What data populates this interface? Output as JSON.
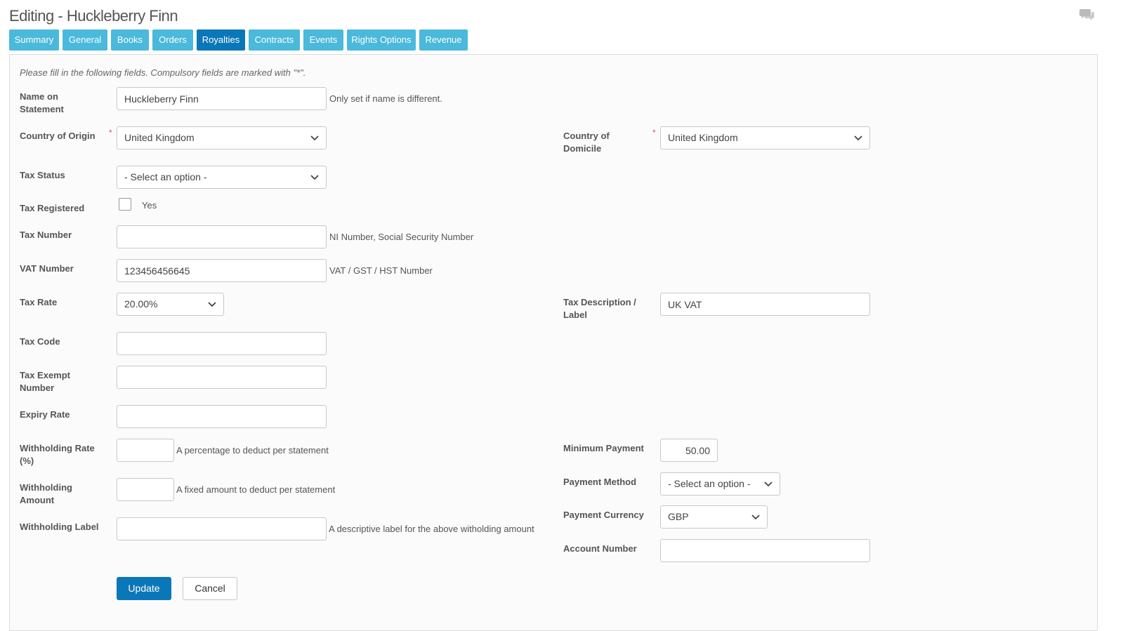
{
  "title": "Editing - Huckleberry Finn",
  "icons": {
    "chat": "chat-bubbles-icon",
    "chevron": "chevron-down-icon"
  },
  "colors": {
    "tab": "#4ab9db",
    "tab_active": "#0a77b8",
    "required": "#d9534f",
    "primary": "#0a77b8"
  },
  "tabs": [
    "Summary",
    "General",
    "Books",
    "Orders",
    "Royalties",
    "Contracts",
    "Events",
    "Rights Options",
    "Revenue"
  ],
  "active_tab": "Royalties",
  "intro": "Please fill in the following fields. Compulsory fields are marked with \"*\".",
  "required_mark": "*",
  "fields": {
    "name_on_statement": {
      "label": "Name on Statement",
      "value": "Huckleberry Finn",
      "help": "Only set if name is different."
    },
    "country_of_origin": {
      "label": "Country of Origin",
      "value": "United Kingdom"
    },
    "country_of_domicile": {
      "label": "Country of Domicile",
      "value": "United Kingdom"
    },
    "tax_status": {
      "label": "Tax Status",
      "value": "- Select an option -"
    },
    "tax_registered": {
      "label": "Tax Registered",
      "option": "Yes",
      "checked": false
    },
    "tax_number": {
      "label": "Tax Number",
      "value": "",
      "help": "NI Number, Social Security Number"
    },
    "vat_number": {
      "label": "VAT Number",
      "value": "123456456645",
      "help": "VAT / GST / HST Number"
    },
    "tax_rate": {
      "label": "Tax Rate",
      "value": "20.00%"
    },
    "tax_description": {
      "label": "Tax Description / Label",
      "value": "UK VAT"
    },
    "tax_code": {
      "label": "Tax Code",
      "value": ""
    },
    "tax_exempt_number": {
      "label": "Tax Exempt Number",
      "value": ""
    },
    "expiry_rate": {
      "label": "Expiry Rate",
      "value": ""
    },
    "withholding_rate": {
      "label": "Withholding Rate (%)",
      "value": "",
      "help": "A percentage to deduct per statement"
    },
    "withholding_amount": {
      "label": "Withholding Amount",
      "value": "",
      "help": "A fixed amount to deduct per statement"
    },
    "withholding_label": {
      "label": "Withholding Label",
      "value": "",
      "help": "A descriptive label for the above witholding amount"
    },
    "minimum_payment": {
      "label": "Minimum Payment",
      "value": "50.00"
    },
    "payment_method": {
      "label": "Payment Method",
      "value": "- Select an option -"
    },
    "payment_currency": {
      "label": "Payment Currency",
      "value": "GBP"
    },
    "account_number": {
      "label": "Account Number",
      "value": ""
    }
  },
  "buttons": {
    "update": "Update",
    "cancel": "Cancel"
  }
}
